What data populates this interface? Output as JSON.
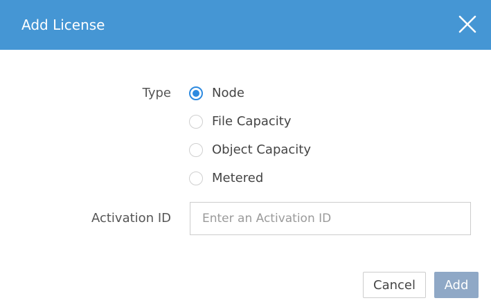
{
  "dialog": {
    "title": "Add License",
    "close_icon": "close-icon",
    "header_color": "#4596d4"
  },
  "form": {
    "type_label": "Type",
    "type_options": [
      {
        "label": "Node",
        "checked": true
      },
      {
        "label": "File Capacity",
        "checked": false
      },
      {
        "label": "Object Capacity",
        "checked": false
      },
      {
        "label": "Metered",
        "checked": false
      }
    ],
    "activation_label": "Activation ID",
    "activation_placeholder": "Enter an Activation ID",
    "activation_value": ""
  },
  "footer": {
    "cancel_label": "Cancel",
    "add_label": "Add",
    "add_color": "#8fa8c6"
  }
}
